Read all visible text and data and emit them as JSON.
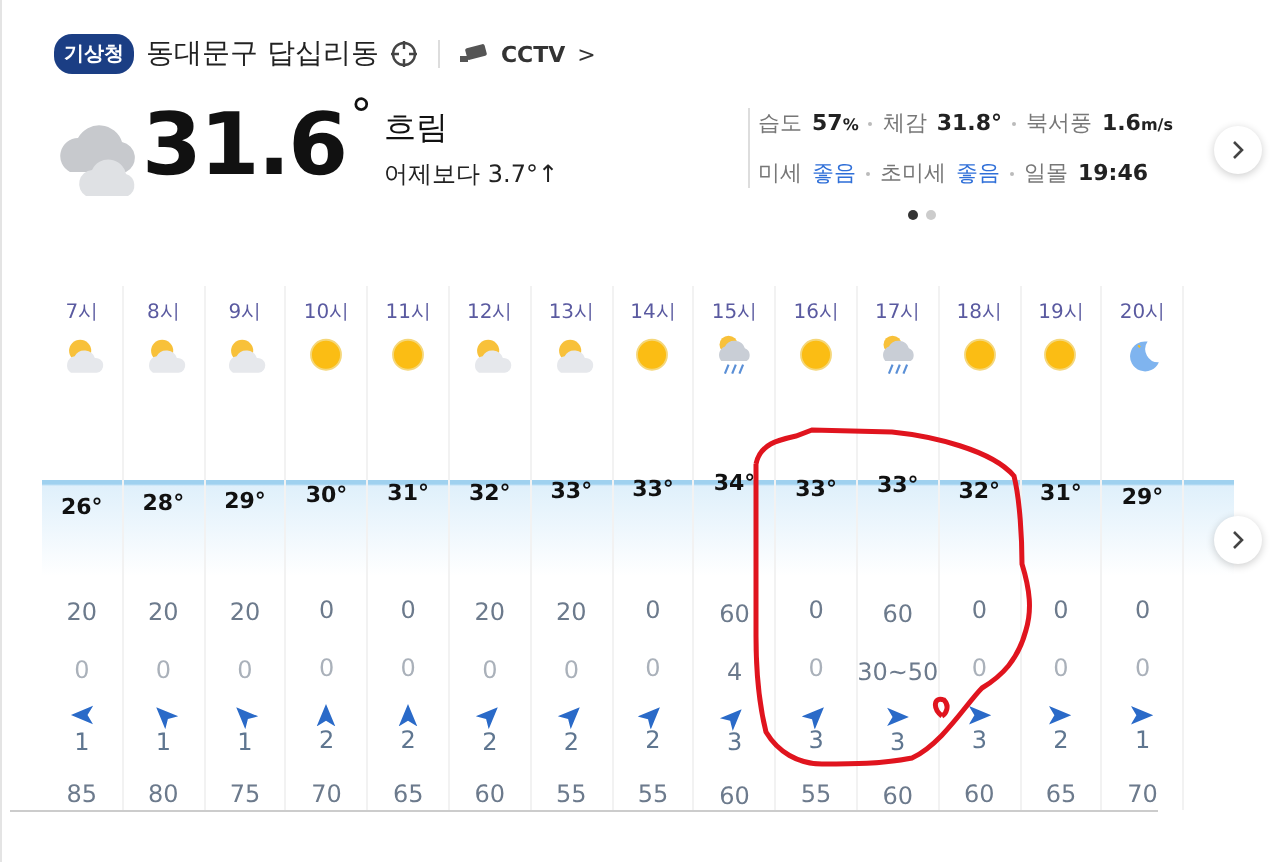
{
  "header": {
    "badge": "기상청",
    "location": "동대문구 답십리동",
    "cctv": "CCTV",
    "cctv_caret": ">"
  },
  "current": {
    "temperature": "31.6",
    "degree": "°",
    "condition": "흐림",
    "compare": "어제보다 3.7°↑"
  },
  "details": [
    [
      {
        "label": "습도",
        "value": "57",
        "unit": "%",
        "good": false
      },
      {
        "label": "체감",
        "value": "31.8°",
        "good": false
      },
      {
        "label": "북서풍",
        "value": "1.6",
        "unit": "m/s",
        "good": false
      }
    ],
    [
      {
        "label": "미세",
        "value": "좋음",
        "good": true
      },
      {
        "label": "초미세",
        "value": "좋음",
        "good": true
      },
      {
        "label": "일몰",
        "value": "19:46",
        "good": false
      }
    ]
  ],
  "pager": [
    {
      "selected": true
    },
    {
      "selected": false
    }
  ],
  "hours": [
    {
      "time": "7시",
      "kind": "partly_cloudy",
      "temp": "26°",
      "precip": "20",
      "amount": "0",
      "wind": {
        "kind": "west",
        "speed": "1"
      },
      "humidity": "85"
    },
    {
      "time": "8시",
      "kind": "partly_cloudy",
      "temp": "28°",
      "precip": "20",
      "amount": "0",
      "wind": {
        "kind": "northwest",
        "speed": "1"
      },
      "humidity": "80"
    },
    {
      "time": "9시",
      "kind": "partly_cloudy",
      "temp": "29°",
      "precip": "20",
      "amount": "0",
      "wind": {
        "kind": "northwest",
        "speed": "1"
      },
      "humidity": "75"
    },
    {
      "time": "10시",
      "kind": "sunny",
      "temp": "30°",
      "precip": "0",
      "amount": "0",
      "wind": {
        "kind": "north",
        "speed": "2"
      },
      "humidity": "70"
    },
    {
      "time": "11시",
      "kind": "sunny",
      "temp": "31°",
      "precip": "0",
      "amount": "0",
      "wind": {
        "kind": "north",
        "speed": "2"
      },
      "humidity": "65"
    },
    {
      "time": "12시",
      "kind": "partly_cloudy",
      "temp": "32°",
      "precip": "20",
      "amount": "0",
      "wind": {
        "kind": "northeast",
        "speed": "2"
      },
      "humidity": "60"
    },
    {
      "time": "13시",
      "kind": "partly_cloudy",
      "temp": "33°",
      "precip": "20",
      "amount": "0",
      "wind": {
        "kind": "northeast",
        "speed": "2"
      },
      "humidity": "55"
    },
    {
      "time": "14시",
      "kind": "sunny",
      "temp": "33°",
      "precip": "0",
      "amount": "0",
      "wind": {
        "kind": "northeast",
        "speed": "2"
      },
      "humidity": "55"
    },
    {
      "time": "15시",
      "kind": "rain",
      "temp": "34°",
      "precip": "60",
      "amount": "4",
      "wind": {
        "kind": "northeast",
        "speed": "3"
      },
      "humidity": "60"
    },
    {
      "time": "16시",
      "kind": "sunny",
      "temp": "33°",
      "precip": "0",
      "amount": "0",
      "wind": {
        "kind": "northeast",
        "speed": "3"
      },
      "humidity": "55"
    },
    {
      "time": "17시",
      "kind": "rain",
      "temp": "33°",
      "precip": "60",
      "amount": "30~50",
      "wind": {
        "kind": "east",
        "speed": "3"
      },
      "humidity": "60"
    },
    {
      "time": "18시",
      "kind": "sunny",
      "temp": "32°",
      "precip": "0",
      "amount": "0",
      "wind": {
        "kind": "east",
        "speed": "3"
      },
      "humidity": "60"
    },
    {
      "time": "19시",
      "kind": "sunny",
      "temp": "31°",
      "precip": "0",
      "amount": "0",
      "wind": {
        "kind": "east",
        "speed": "2"
      },
      "humidity": "65"
    },
    {
      "time": "20시",
      "kind": "moon",
      "temp": "29°",
      "precip": "0",
      "amount": "0",
      "wind": {
        "kind": "east",
        "speed": "1"
      },
      "humidity": "70"
    }
  ]
}
